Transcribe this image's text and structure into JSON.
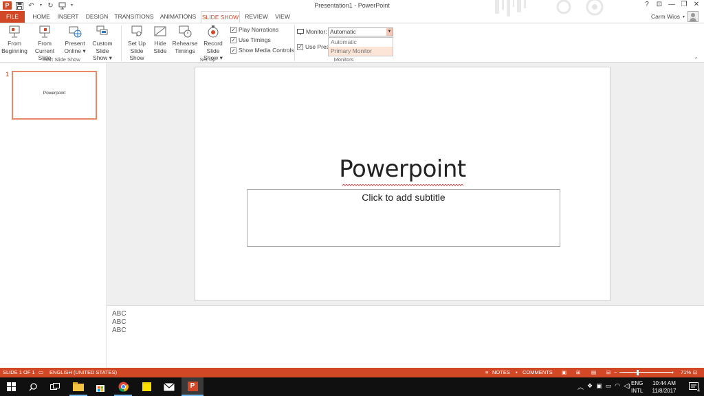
{
  "window": {
    "title": "Presentation1 - PowerPoint",
    "qat_icons": [
      "powerpoint-logo",
      "save-icon",
      "undo-icon",
      "redo-icon",
      "start-from-beginning-icon"
    ],
    "controls": [
      "?",
      "⊡",
      "—",
      "❐",
      "✕"
    ]
  },
  "tabs": [
    {
      "label": "FILE"
    },
    {
      "label": "HOME"
    },
    {
      "label": "INSERT"
    },
    {
      "label": "DESIGN"
    },
    {
      "label": "TRANSITIONS"
    },
    {
      "label": "ANIMATIONS"
    },
    {
      "label": "SLIDE SHOW"
    },
    {
      "label": "REVIEW"
    },
    {
      "label": "VIEW"
    }
  ],
  "active_tab": "SLIDE SHOW",
  "account": {
    "name": "Carm Wios",
    "caret": "▾"
  },
  "ribbon": {
    "start_group": {
      "label": "Start Slide Show",
      "from_beginning": [
        "From",
        "Beginning"
      ],
      "from_current": [
        "From",
        "Current Slide"
      ],
      "present_online": [
        "Present",
        "Online ▾"
      ],
      "custom_show": [
        "Custom Slide",
        "Show ▾"
      ]
    },
    "setup_group": {
      "label": "Set Up",
      "setup_show": [
        "Set Up",
        "Slide Show"
      ],
      "hide_slide": [
        "Hide",
        "Slide"
      ],
      "rehearse": [
        "Rehearse",
        "Timings"
      ],
      "record": [
        "Record Slide",
        "Show ▾"
      ],
      "play_narrations": "Play Narrations",
      "use_timings": "Use Timings",
      "show_media_controls": "Show Media Controls"
    },
    "monitors_group": {
      "label": "Monitors",
      "monitor_label": "Monitor:",
      "monitor_value": "Automatic",
      "use_presenter": "Use Prese",
      "options": [
        "Automatic",
        "Primary Monitor"
      ],
      "highlighted_option": "Primary Monitor"
    },
    "collapse": "⌃"
  },
  "thumbnail": {
    "number": "1",
    "title": "Powerpoint"
  },
  "slide": {
    "title": "Powerpoint",
    "subtitle_placeholder": "Click to add subtitle"
  },
  "notes": [
    "ABC",
    "ABC",
    "ABC"
  ],
  "status": {
    "slide_info": "SLIDE 1 OF 1",
    "language": "ENGLISH (UNITED STATES)",
    "notes": "NOTES",
    "comments": "COMMENTS",
    "zoom_out": "−",
    "zoom_in": "+",
    "zoom": "71%",
    "zoom_level_percent": 71
  },
  "taskbar": {
    "lang": [
      "ENG",
      "INTL"
    ],
    "time": "10:44 AM",
    "date": "11/8/2017",
    "notification_count": "4"
  },
  "colors": {
    "accent": "#d24726",
    "taskbar": "#101010",
    "taskbar_highlight": "#76b9ed"
  }
}
